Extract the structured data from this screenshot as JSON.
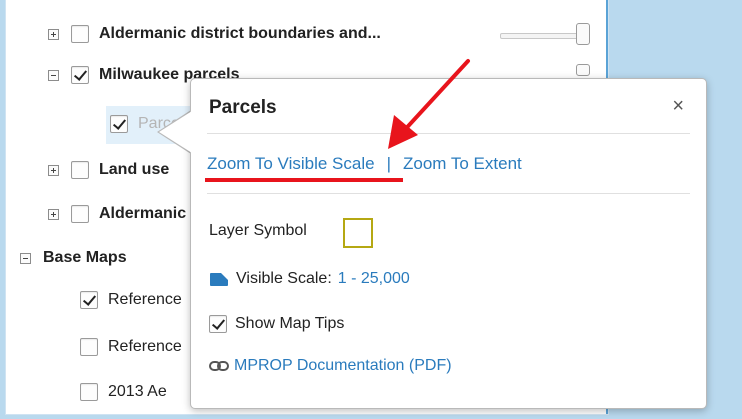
{
  "layers": [
    {
      "label": "Aldermanic district boundaries and...",
      "bold": true,
      "checked": false,
      "expander": "plus"
    },
    {
      "label": "Milwaukee parcels",
      "bold": true,
      "checked": true,
      "expander": "minus"
    },
    {
      "label": "Parcels",
      "checked": true
    },
    {
      "label": "Land use",
      "bold": true,
      "checked": false,
      "expander": "plus"
    },
    {
      "label": "Aldermanic",
      "bold": true,
      "checked": false,
      "expander": "plus"
    }
  ],
  "base_maps": {
    "label": "Base Maps",
    "items": [
      {
        "label": "Reference",
        "checked": true
      },
      {
        "label": "Reference",
        "checked": false
      },
      {
        "label": "2013 Ae",
        "checked": false
      }
    ]
  },
  "popup": {
    "title": "Parcels",
    "close_glyph": "×",
    "zoom_visible": "Zoom To Visible Scale",
    "separator": "|",
    "zoom_extent": "Zoom To Extent",
    "layer_symbol": "Layer Symbol",
    "visible_scale_label": "Visible Scale:",
    "visible_scale_value": "1 - 25,000",
    "show_map_tips": "Show Map Tips",
    "documentation": "MPROP Documentation (PDF)"
  },
  "colors": {
    "link": "#2a7bbd",
    "annotation": "#e8141c",
    "symbol": "#b5a813"
  }
}
